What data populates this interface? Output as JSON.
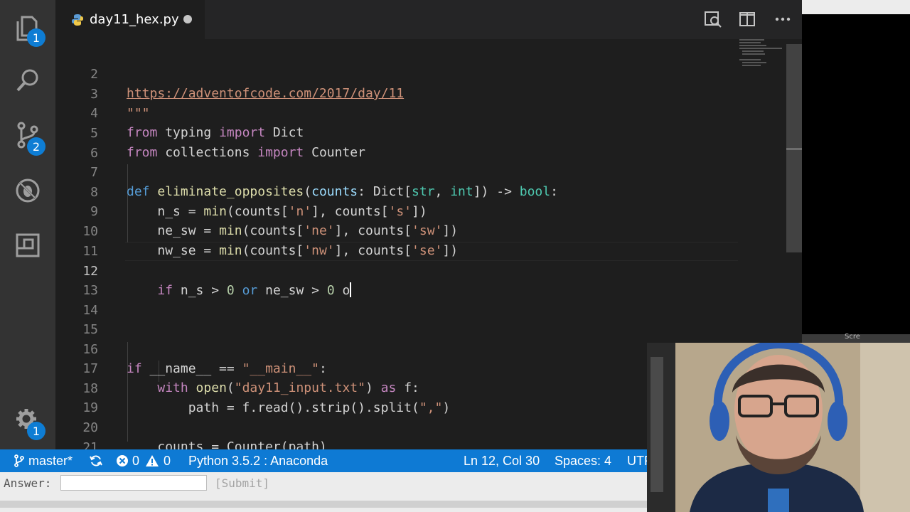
{
  "activity_bar": {
    "explorer_badge": "1",
    "scm_badge": "2",
    "settings_badge": "1"
  },
  "tab": {
    "title": "day11_hex.py"
  },
  "editor": {
    "lines": [
      {
        "n": "2"
      },
      {
        "n": "3"
      },
      {
        "n": "4"
      },
      {
        "n": "5"
      },
      {
        "n": "6"
      },
      {
        "n": "7"
      },
      {
        "n": "8"
      },
      {
        "n": "9"
      },
      {
        "n": "10"
      },
      {
        "n": "11"
      },
      {
        "n": "12"
      },
      {
        "n": "13"
      },
      {
        "n": "14"
      },
      {
        "n": "15"
      },
      {
        "n": "16"
      },
      {
        "n": "17"
      },
      {
        "n": "18"
      },
      {
        "n": "19"
      },
      {
        "n": "20"
      },
      {
        "n": "21"
      }
    ],
    "code": {
      "l2_url": "https://adventofcode.com/2017/day/11",
      "l3": "\"\"\"",
      "l4_a": "from",
      "l4_b": " typing ",
      "l4_c": "import",
      "l4_d": " Dict",
      "l5_a": "from",
      "l5_b": " collections ",
      "l5_c": "import",
      "l5_d": " Counter",
      "l7_def": "def",
      "l7_fn": "eliminate_opposites",
      "l7_p1": "(",
      "l7_param": "counts",
      "l7_p2": ": Dict[",
      "l7_str": "str",
      "l7_comma": ", ",
      "l7_int": "int",
      "l7_p3": "]) -> ",
      "l7_bool": "bool",
      "l7_colon": ":",
      "l8_a": "n_s = ",
      "l8_fn": "min",
      "l8_b": "(counts[",
      "l8_s1": "'n'",
      "l8_c": "], counts[",
      "l8_s2": "'s'",
      "l8_d": "])",
      "l9_a": "ne_sw = ",
      "l9_fn": "min",
      "l9_b": "(counts[",
      "l9_s1": "'ne'",
      "l9_c": "], counts[",
      "l9_s2": "'sw'",
      "l9_d": "])",
      "l10_a": "nw_se = ",
      "l10_fn": "min",
      "l10_b": "(counts[",
      "l10_s1": "'nw'",
      "l10_c": "], counts[",
      "l10_s2": "'se'",
      "l10_d": "])",
      "l12_if": "if",
      "l12_a": " n_s > ",
      "l12_n1": "0",
      "l12_or": " or",
      "l12_b": " ne_sw > ",
      "l12_n2": "0",
      "l12_c": " o",
      "l16_if": "if",
      "l16_a": " __name__ == ",
      "l16_s": "\"__main__\"",
      "l16_b": ":",
      "l17_with": "with",
      "l17_fn": " open",
      "l17_a": "(",
      "l17_s": "\"day11_input.txt\"",
      "l17_b": ") ",
      "l17_as": "as",
      "l17_c": " f:",
      "l18_a": "path = f.read().strip().split(",
      "l18_s": "\",\"",
      "l18_b": ")",
      "l20_a": "counts = Counter(path)"
    }
  },
  "status_bar": {
    "branch": "master*",
    "errors": "0",
    "warnings": "0",
    "interpreter": "Python 3.5.2 : Anaconda",
    "position": "Ln 12, Col 30",
    "spaces": "Spaces: 4",
    "encoding": "UTF"
  },
  "answer_bar": {
    "label": "Answer:",
    "submit": "[Submit]"
  },
  "right_panel": {
    "label": "Scre"
  },
  "colors": {
    "status_bar": "#0e7ad4",
    "keyword": "#c586c0",
    "function": "#dcdcaa",
    "string": "#ce9178",
    "badge": "#0e7dd4"
  }
}
